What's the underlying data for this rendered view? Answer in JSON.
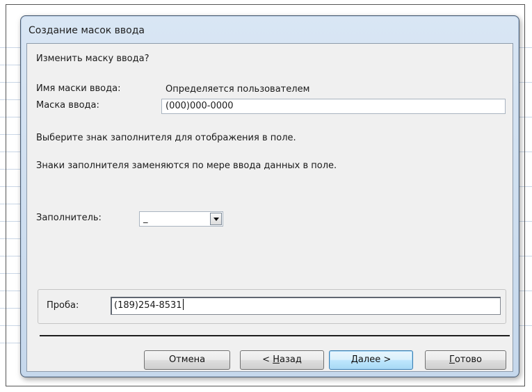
{
  "window": {
    "title": "Создание масок ввода"
  },
  "prompt": "Изменить маску ввода?",
  "mask_name": {
    "label": "Имя маски ввода:",
    "value": "Определяется пользователем"
  },
  "mask": {
    "label": "Маска ввода:",
    "value": "(000)000-0000"
  },
  "info": {
    "line1": "Выберите знак заполнителя для отображения в поле.",
    "line2": "Знаки заполнителя заменяются по мере ввода данных в поле."
  },
  "placeholder_select": {
    "label": "Заполнитель:",
    "value": "_"
  },
  "test": {
    "label": "Проба:",
    "value": "(189)254-8531"
  },
  "buttons": {
    "cancel": "Отмена",
    "back_prefix": "< ",
    "back_hotkey": "Н",
    "back_rest": "азад",
    "next_hotkey": "Д",
    "next_rest": "алее >",
    "finish_hotkey": "Г",
    "finish_rest": "отово"
  },
  "colors": {
    "title_bar": "#c6d8ec",
    "client_bg": "#f0f0f0",
    "default_button": "#bee6fd"
  }
}
